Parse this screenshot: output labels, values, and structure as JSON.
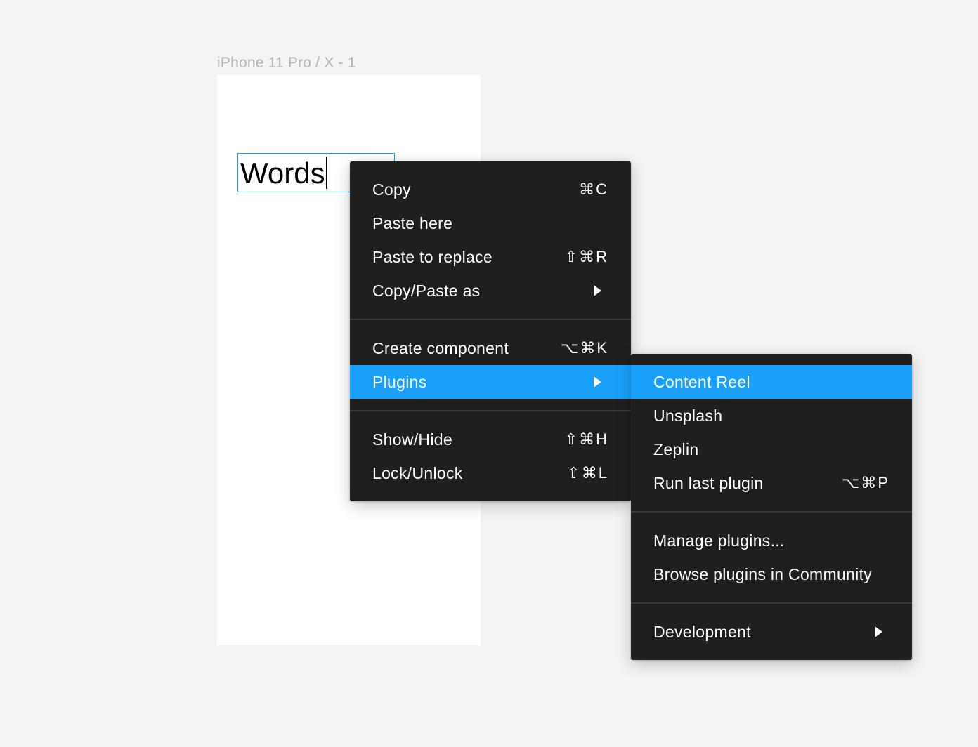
{
  "canvas": {
    "frame_label": "iPhone 11 Pro / X - 1",
    "text_layer_content": "Words",
    "selection_color": "#18a0fb"
  },
  "context_menu": {
    "copy": {
      "label": "Copy",
      "shortcut": "⌘C"
    },
    "paste_here": {
      "label": "Paste here"
    },
    "paste_to_replace": {
      "label": "Paste to replace",
      "shortcut": "⇧⌘R"
    },
    "copy_paste_as": {
      "label": "Copy/Paste as"
    },
    "create_component": {
      "label": "Create component",
      "shortcut": "⌥⌘K"
    },
    "plugins": {
      "label": "Plugins"
    },
    "show_hide": {
      "label": "Show/Hide",
      "shortcut": "⇧⌘H"
    },
    "lock_unlock": {
      "label": "Lock/Unlock",
      "shortcut": "⇧⌘L"
    }
  },
  "plugins_submenu": {
    "content_reel": {
      "label": "Content Reel"
    },
    "unsplash": {
      "label": "Unsplash"
    },
    "zeplin": {
      "label": "Zeplin"
    },
    "run_last_plugin": {
      "label": "Run last plugin",
      "shortcut": "⌥⌘P"
    },
    "manage_plugins": {
      "label": "Manage plugins..."
    },
    "browse_plugins": {
      "label": "Browse plugins in Community"
    },
    "development": {
      "label": "Development"
    }
  },
  "colors": {
    "menu_background": "#1f1f1f",
    "highlight": "#18a0fb",
    "canvas_background": "#f4f4f4"
  }
}
